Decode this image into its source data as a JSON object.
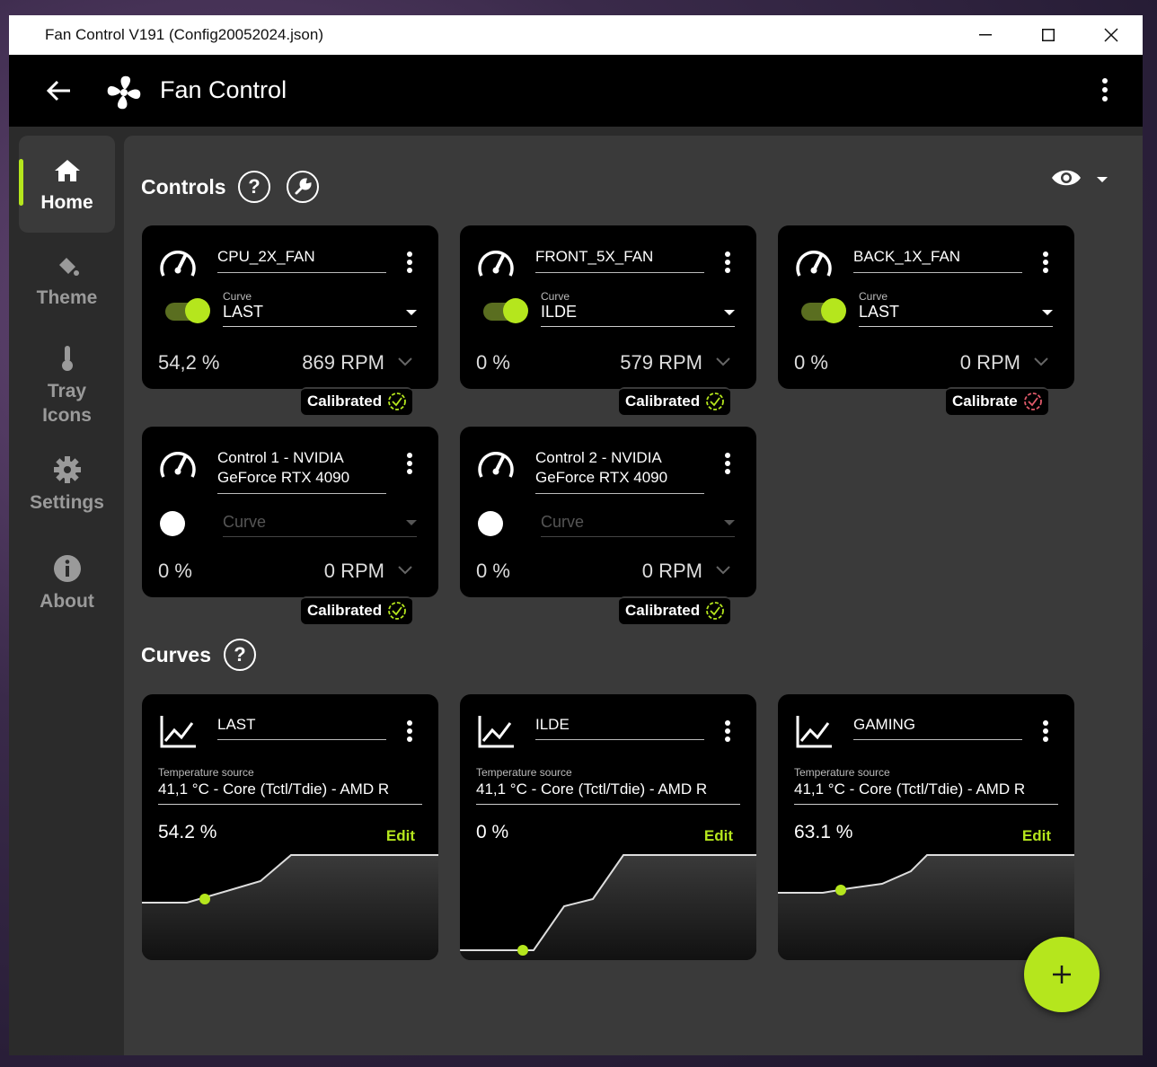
{
  "window": {
    "title": "Fan Control V191 (Config20052024.json)"
  },
  "appbar": {
    "title": "Fan Control"
  },
  "sidebar": {
    "items": [
      {
        "label": "Home",
        "icon": "home-icon"
      },
      {
        "label": "Theme",
        "icon": "paint-bucket-icon"
      },
      {
        "label": "Tray Icons",
        "icon": "thermometer-icon"
      },
      {
        "label": "Settings",
        "icon": "gear-icon"
      },
      {
        "label": "About",
        "icon": "info-icon"
      }
    ]
  },
  "controls": {
    "title": "Controls",
    "cards": [
      {
        "name": "CPU_2X_FAN",
        "curve_label": "Curve",
        "curve": "LAST",
        "enabled": true,
        "percent": "54,2 %",
        "rpm": "869 RPM",
        "badge": "Calibrated",
        "calibrated": true
      },
      {
        "name": "FRONT_5X_FAN",
        "curve_label": "Curve",
        "curve": "ILDE",
        "enabled": true,
        "percent": "0 %",
        "rpm": "579 RPM",
        "badge": "Calibrated",
        "calibrated": true
      },
      {
        "name": "BACK_1X_FAN",
        "curve_label": "Curve",
        "curve": "LAST",
        "enabled": true,
        "percent": "0 %",
        "rpm": "0 RPM",
        "badge": "Calibrate",
        "calibrated": false
      },
      {
        "name_line1": "Control 1 - NVIDIA",
        "name_line2": "GeForce RTX 4090",
        "curve": "Curve",
        "enabled": false,
        "percent": "0 %",
        "rpm": "0 RPM",
        "badge": "Calibrated",
        "calibrated": true
      },
      {
        "name_line1": "Control 2 - NVIDIA",
        "name_line2": "GeForce RTX 4090",
        "curve": "Curve",
        "enabled": false,
        "percent": "0 %",
        "rpm": "0 RPM",
        "badge": "Calibrated",
        "calibrated": true
      }
    ]
  },
  "curves": {
    "title": "Curves",
    "cards": [
      {
        "name": "LAST",
        "ts_label": "Temperature source",
        "ts_value": "41,1 °C - Core (Tctl/Tdie) - AMD R",
        "percent": "54.2 %",
        "edit": "Edit"
      },
      {
        "name": "ILDE",
        "ts_label": "Temperature source",
        "ts_value": "41,1 °C - Core (Tctl/Tdie) - AMD R",
        "percent": "0 %",
        "edit": "Edit"
      },
      {
        "name": "GAMING",
        "ts_label": "Temperature source",
        "ts_value": "41,1 °C - Core (Tctl/Tdie) - AMD R",
        "percent": "63.1 %",
        "edit": "Edit"
      }
    ]
  },
  "colors": {
    "accent": "#b5e61d",
    "uncalibrated": "#e05a6a"
  }
}
